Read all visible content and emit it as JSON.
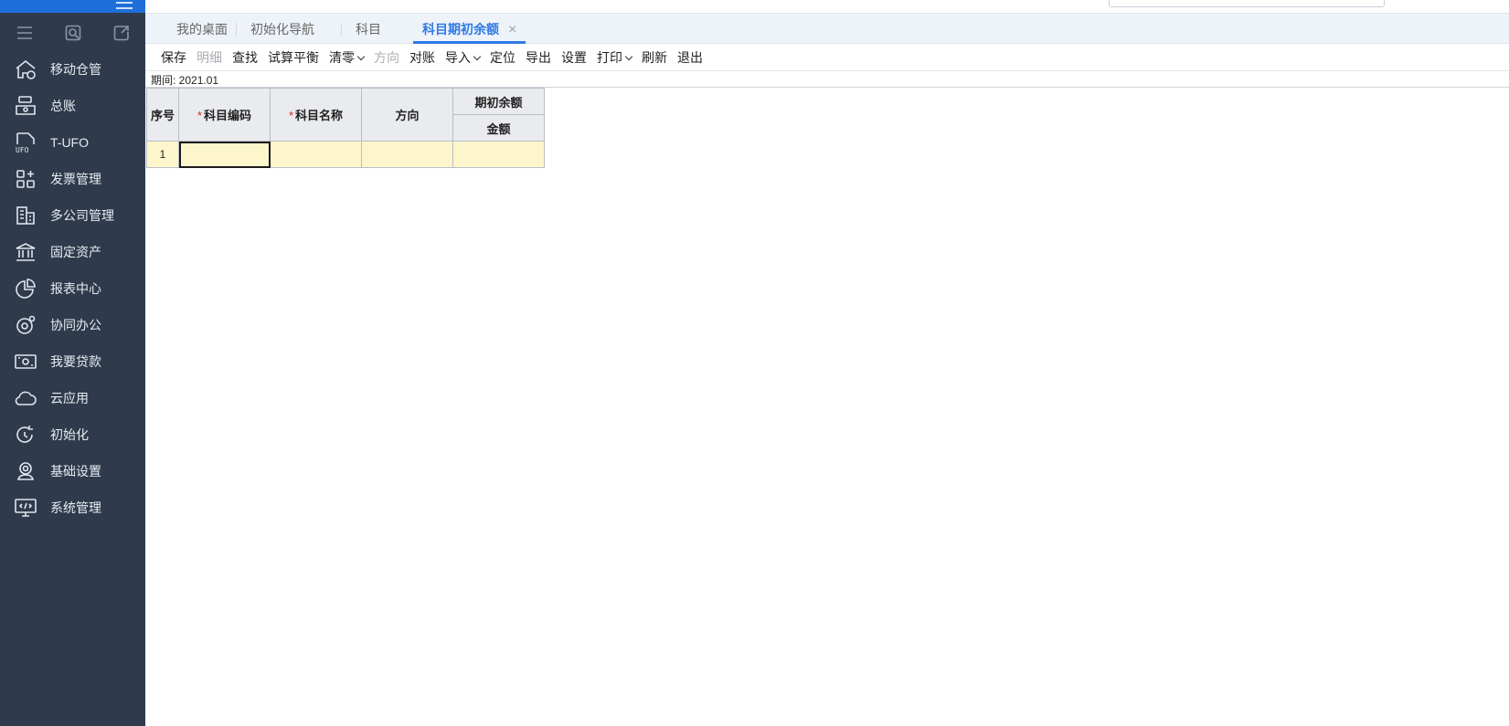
{
  "sidebar": {
    "tools": [
      {
        "icon": "menu-icon"
      },
      {
        "icon": "search-doc-icon"
      },
      {
        "icon": "export-icon"
      }
    ],
    "items": [
      {
        "label": "移动仓管",
        "icon": "warehouse-icon"
      },
      {
        "label": "总账",
        "icon": "ledger-icon"
      },
      {
        "label": "T-UFO",
        "icon": "ufo-report-icon"
      },
      {
        "label": "发票管理",
        "icon": "invoice-apps-icon"
      },
      {
        "label": "多公司管理",
        "icon": "building-icon"
      },
      {
        "label": "固定资产",
        "icon": "bank-icon"
      },
      {
        "label": "报表中心",
        "icon": "pie-chart-icon"
      },
      {
        "label": "协同办公",
        "icon": "collab-icon"
      },
      {
        "label": "我要贷款",
        "icon": "money-icon"
      },
      {
        "label": "云应用",
        "icon": "cloud-icon"
      },
      {
        "label": "初始化",
        "icon": "refresh-icon"
      },
      {
        "label": "基础设置",
        "icon": "settings-person-icon"
      },
      {
        "label": "系统管理",
        "icon": "monitor-code-icon"
      }
    ]
  },
  "tabs": [
    {
      "label": "我的桌面"
    },
    {
      "label": "初始化导航"
    },
    {
      "label": "科目"
    },
    {
      "label": "科目期初余额",
      "active": true
    }
  ],
  "tab_close": "×",
  "toolbar": {
    "buttons": [
      {
        "label": "保存"
      },
      {
        "label": "明细",
        "disabled": true
      },
      {
        "label": "查找"
      },
      {
        "label": "试算平衡"
      },
      {
        "label": "清零",
        "dropdown": true
      },
      {
        "label": "方向",
        "disabled": true
      },
      {
        "label": "对账"
      },
      {
        "label": "导入",
        "dropdown": true
      },
      {
        "label": "定位"
      },
      {
        "label": "导出"
      },
      {
        "label": "设置"
      },
      {
        "label": "打印",
        "dropdown": true
      },
      {
        "label": "刷新"
      },
      {
        "label": "退出"
      }
    ]
  },
  "period": {
    "label": "期间: 2021.01"
  },
  "grid": {
    "headers": {
      "index": "序号",
      "code": "科目编码",
      "name": "科目名称",
      "direction": "方向",
      "opening_group": "期初余额",
      "amount": "金额"
    },
    "required_mark": "*",
    "rows": [
      {
        "index": "1",
        "code": "",
        "name": "",
        "direction": "",
        "amount": ""
      }
    ]
  },
  "colors": {
    "sidebar_bg": "#2f3b4c",
    "accent": "#2f7ae5",
    "row_bg": "#fdf6cc",
    "header_bg": "#e9ebee"
  }
}
